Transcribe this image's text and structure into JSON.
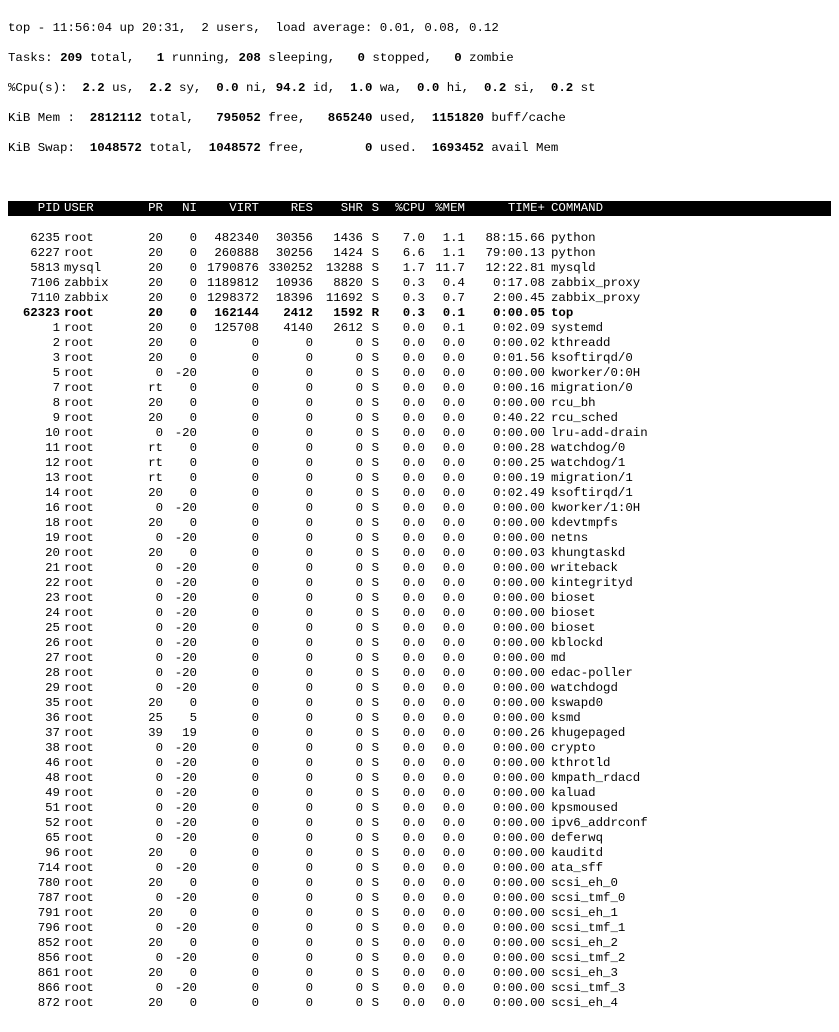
{
  "summary": {
    "l1": "top - 11:56:04 up 20:31,  2 users,  load average: 0.01, 0.08, 0.12",
    "l2a": "Tasks: ",
    "l2b": "209 ",
    "l2c": "total,   ",
    "l2d": "1 ",
    "l2e": "running, ",
    "l2f": "208 ",
    "l2g": "sleeping,   ",
    "l2h": "0 ",
    "l2i": "stopped,   ",
    "l2j": "0 ",
    "l2k": "zombie",
    "l3a": "%Cpu(s):  ",
    "l3b": "2.2 ",
    "l3c": "us,  ",
    "l3d": "2.2 ",
    "l3e": "sy,  ",
    "l3f": "0.0 ",
    "l3g": "ni, ",
    "l3h": "94.2 ",
    "l3i": "id,  ",
    "l3j": "1.0 ",
    "l3k": "wa,  ",
    "l3l": "0.0 ",
    "l3m": "hi,  ",
    "l3n": "0.2 ",
    "l3o": "si,  ",
    "l3p": "0.2 ",
    "l3q": "st",
    "l4a": "KiB Mem :  ",
    "l4b": "2812112 ",
    "l4c": "total,   ",
    "l4d": "795052 ",
    "l4e": "free,   ",
    "l4f": "865240 ",
    "l4g": "used,  ",
    "l4h": "1151820 ",
    "l4i": "buff/cache",
    "l5a": "KiB Swap:  ",
    "l5b": "1048572 ",
    "l5c": "total,  ",
    "l5d": "1048572 ",
    "l5e": "free,        ",
    "l5f": "0 ",
    "l5g": "used.  ",
    "l5h": "1693452 ",
    "l5i": "avail Mem"
  },
  "cols": {
    "pid": "PID",
    "user": "USER",
    "pr": "PR",
    "ni": "NI",
    "virt": "VIRT",
    "res": "RES",
    "shr": "SHR",
    "s": "S",
    "cpu": "%CPU",
    "mem": "%MEM",
    "time": "TIME+",
    "cmd": "COMMAND"
  },
  "rows": [
    {
      "pid": "6235",
      "user": "root",
      "pr": "20",
      "ni": "0",
      "virt": "482340",
      "res": "30356",
      "shr": "1436",
      "s": "S",
      "cpu": "7.0",
      "mem": "1.1",
      "time": "88:15.66",
      "cmd": "python"
    },
    {
      "pid": "6227",
      "user": "root",
      "pr": "20",
      "ni": "0",
      "virt": "260888",
      "res": "30256",
      "shr": "1424",
      "s": "S",
      "cpu": "6.6",
      "mem": "1.1",
      "time": "79:00.13",
      "cmd": "python"
    },
    {
      "pid": "5813",
      "user": "mysql",
      "pr": "20",
      "ni": "0",
      "virt": "1790876",
      "res": "330252",
      "shr": "13288",
      "s": "S",
      "cpu": "1.7",
      "mem": "11.7",
      "time": "12:22.81",
      "cmd": "mysqld"
    },
    {
      "pid": "7106",
      "user": "zabbix",
      "pr": "20",
      "ni": "0",
      "virt": "1189812",
      "res": "10936",
      "shr": "8820",
      "s": "S",
      "cpu": "0.3",
      "mem": "0.4",
      "time": "0:17.08",
      "cmd": "zabbix_proxy"
    },
    {
      "pid": "7110",
      "user": "zabbix",
      "pr": "20",
      "ni": "0",
      "virt": "1298372",
      "res": "18396",
      "shr": "11692",
      "s": "S",
      "cpu": "0.3",
      "mem": "0.7",
      "time": "2:00.45",
      "cmd": "zabbix_proxy"
    },
    {
      "pid": "62323",
      "user": "root",
      "pr": "20",
      "ni": "0",
      "virt": "162144",
      "res": "2412",
      "shr": "1592",
      "s": "R",
      "cpu": "0.3",
      "mem": "0.1",
      "time": "0:00.05",
      "cmd": "top",
      "bold": true
    },
    {
      "pid": "1",
      "user": "root",
      "pr": "20",
      "ni": "0",
      "virt": "125708",
      "res": "4140",
      "shr": "2612",
      "s": "S",
      "cpu": "0.0",
      "mem": "0.1",
      "time": "0:02.09",
      "cmd": "systemd"
    },
    {
      "pid": "2",
      "user": "root",
      "pr": "20",
      "ni": "0",
      "virt": "0",
      "res": "0",
      "shr": "0",
      "s": "S",
      "cpu": "0.0",
      "mem": "0.0",
      "time": "0:00.02",
      "cmd": "kthreadd"
    },
    {
      "pid": "3",
      "user": "root",
      "pr": "20",
      "ni": "0",
      "virt": "0",
      "res": "0",
      "shr": "0",
      "s": "S",
      "cpu": "0.0",
      "mem": "0.0",
      "time": "0:01.56",
      "cmd": "ksoftirqd/0"
    },
    {
      "pid": "5",
      "user": "root",
      "pr": "0",
      "ni": "-20",
      "virt": "0",
      "res": "0",
      "shr": "0",
      "s": "S",
      "cpu": "0.0",
      "mem": "0.0",
      "time": "0:00.00",
      "cmd": "kworker/0:0H"
    },
    {
      "pid": "7",
      "user": "root",
      "pr": "rt",
      "ni": "0",
      "virt": "0",
      "res": "0",
      "shr": "0",
      "s": "S",
      "cpu": "0.0",
      "mem": "0.0",
      "time": "0:00.16",
      "cmd": "migration/0"
    },
    {
      "pid": "8",
      "user": "root",
      "pr": "20",
      "ni": "0",
      "virt": "0",
      "res": "0",
      "shr": "0",
      "s": "S",
      "cpu": "0.0",
      "mem": "0.0",
      "time": "0:00.00",
      "cmd": "rcu_bh"
    },
    {
      "pid": "9",
      "user": "root",
      "pr": "20",
      "ni": "0",
      "virt": "0",
      "res": "0",
      "shr": "0",
      "s": "S",
      "cpu": "0.0",
      "mem": "0.0",
      "time": "0:40.22",
      "cmd": "rcu_sched"
    },
    {
      "pid": "10",
      "user": "root",
      "pr": "0",
      "ni": "-20",
      "virt": "0",
      "res": "0",
      "shr": "0",
      "s": "S",
      "cpu": "0.0",
      "mem": "0.0",
      "time": "0:00.00",
      "cmd": "lru-add-drain"
    },
    {
      "pid": "11",
      "user": "root",
      "pr": "rt",
      "ni": "0",
      "virt": "0",
      "res": "0",
      "shr": "0",
      "s": "S",
      "cpu": "0.0",
      "mem": "0.0",
      "time": "0:00.28",
      "cmd": "watchdog/0"
    },
    {
      "pid": "12",
      "user": "root",
      "pr": "rt",
      "ni": "0",
      "virt": "0",
      "res": "0",
      "shr": "0",
      "s": "S",
      "cpu": "0.0",
      "mem": "0.0",
      "time": "0:00.25",
      "cmd": "watchdog/1"
    },
    {
      "pid": "13",
      "user": "root",
      "pr": "rt",
      "ni": "0",
      "virt": "0",
      "res": "0",
      "shr": "0",
      "s": "S",
      "cpu": "0.0",
      "mem": "0.0",
      "time": "0:00.19",
      "cmd": "migration/1"
    },
    {
      "pid": "14",
      "user": "root",
      "pr": "20",
      "ni": "0",
      "virt": "0",
      "res": "0",
      "shr": "0",
      "s": "S",
      "cpu": "0.0",
      "mem": "0.0",
      "time": "0:02.49",
      "cmd": "ksoftirqd/1"
    },
    {
      "pid": "16",
      "user": "root",
      "pr": "0",
      "ni": "-20",
      "virt": "0",
      "res": "0",
      "shr": "0",
      "s": "S",
      "cpu": "0.0",
      "mem": "0.0",
      "time": "0:00.00",
      "cmd": "kworker/1:0H"
    },
    {
      "pid": "18",
      "user": "root",
      "pr": "20",
      "ni": "0",
      "virt": "0",
      "res": "0",
      "shr": "0",
      "s": "S",
      "cpu": "0.0",
      "mem": "0.0",
      "time": "0:00.00",
      "cmd": "kdevtmpfs"
    },
    {
      "pid": "19",
      "user": "root",
      "pr": "0",
      "ni": "-20",
      "virt": "0",
      "res": "0",
      "shr": "0",
      "s": "S",
      "cpu": "0.0",
      "mem": "0.0",
      "time": "0:00.00",
      "cmd": "netns"
    },
    {
      "pid": "20",
      "user": "root",
      "pr": "20",
      "ni": "0",
      "virt": "0",
      "res": "0",
      "shr": "0",
      "s": "S",
      "cpu": "0.0",
      "mem": "0.0",
      "time": "0:00.03",
      "cmd": "khungtaskd"
    },
    {
      "pid": "21",
      "user": "root",
      "pr": "0",
      "ni": "-20",
      "virt": "0",
      "res": "0",
      "shr": "0",
      "s": "S",
      "cpu": "0.0",
      "mem": "0.0",
      "time": "0:00.00",
      "cmd": "writeback"
    },
    {
      "pid": "22",
      "user": "root",
      "pr": "0",
      "ni": "-20",
      "virt": "0",
      "res": "0",
      "shr": "0",
      "s": "S",
      "cpu": "0.0",
      "mem": "0.0",
      "time": "0:00.00",
      "cmd": "kintegrityd"
    },
    {
      "pid": "23",
      "user": "root",
      "pr": "0",
      "ni": "-20",
      "virt": "0",
      "res": "0",
      "shr": "0",
      "s": "S",
      "cpu": "0.0",
      "mem": "0.0",
      "time": "0:00.00",
      "cmd": "bioset"
    },
    {
      "pid": "24",
      "user": "root",
      "pr": "0",
      "ni": "-20",
      "virt": "0",
      "res": "0",
      "shr": "0",
      "s": "S",
      "cpu": "0.0",
      "mem": "0.0",
      "time": "0:00.00",
      "cmd": "bioset"
    },
    {
      "pid": "25",
      "user": "root",
      "pr": "0",
      "ni": "-20",
      "virt": "0",
      "res": "0",
      "shr": "0",
      "s": "S",
      "cpu": "0.0",
      "mem": "0.0",
      "time": "0:00.00",
      "cmd": "bioset"
    },
    {
      "pid": "26",
      "user": "root",
      "pr": "0",
      "ni": "-20",
      "virt": "0",
      "res": "0",
      "shr": "0",
      "s": "S",
      "cpu": "0.0",
      "mem": "0.0",
      "time": "0:00.00",
      "cmd": "kblockd"
    },
    {
      "pid": "27",
      "user": "root",
      "pr": "0",
      "ni": "-20",
      "virt": "0",
      "res": "0",
      "shr": "0",
      "s": "S",
      "cpu": "0.0",
      "mem": "0.0",
      "time": "0:00.00",
      "cmd": "md"
    },
    {
      "pid": "28",
      "user": "root",
      "pr": "0",
      "ni": "-20",
      "virt": "0",
      "res": "0",
      "shr": "0",
      "s": "S",
      "cpu": "0.0",
      "mem": "0.0",
      "time": "0:00.00",
      "cmd": "edac-poller"
    },
    {
      "pid": "29",
      "user": "root",
      "pr": "0",
      "ni": "-20",
      "virt": "0",
      "res": "0",
      "shr": "0",
      "s": "S",
      "cpu": "0.0",
      "mem": "0.0",
      "time": "0:00.00",
      "cmd": "watchdogd"
    },
    {
      "pid": "35",
      "user": "root",
      "pr": "20",
      "ni": "0",
      "virt": "0",
      "res": "0",
      "shr": "0",
      "s": "S",
      "cpu": "0.0",
      "mem": "0.0",
      "time": "0:00.00",
      "cmd": "kswapd0"
    },
    {
      "pid": "36",
      "user": "root",
      "pr": "25",
      "ni": "5",
      "virt": "0",
      "res": "0",
      "shr": "0",
      "s": "S",
      "cpu": "0.0",
      "mem": "0.0",
      "time": "0:00.00",
      "cmd": "ksmd"
    },
    {
      "pid": "37",
      "user": "root",
      "pr": "39",
      "ni": "19",
      "virt": "0",
      "res": "0",
      "shr": "0",
      "s": "S",
      "cpu": "0.0",
      "mem": "0.0",
      "time": "0:00.26",
      "cmd": "khugepaged"
    },
    {
      "pid": "38",
      "user": "root",
      "pr": "0",
      "ni": "-20",
      "virt": "0",
      "res": "0",
      "shr": "0",
      "s": "S",
      "cpu": "0.0",
      "mem": "0.0",
      "time": "0:00.00",
      "cmd": "crypto"
    },
    {
      "pid": "46",
      "user": "root",
      "pr": "0",
      "ni": "-20",
      "virt": "0",
      "res": "0",
      "shr": "0",
      "s": "S",
      "cpu": "0.0",
      "mem": "0.0",
      "time": "0:00.00",
      "cmd": "kthrotld"
    },
    {
      "pid": "48",
      "user": "root",
      "pr": "0",
      "ni": "-20",
      "virt": "0",
      "res": "0",
      "shr": "0",
      "s": "S",
      "cpu": "0.0",
      "mem": "0.0",
      "time": "0:00.00",
      "cmd": "kmpath_rdacd"
    },
    {
      "pid": "49",
      "user": "root",
      "pr": "0",
      "ni": "-20",
      "virt": "0",
      "res": "0",
      "shr": "0",
      "s": "S",
      "cpu": "0.0",
      "mem": "0.0",
      "time": "0:00.00",
      "cmd": "kaluad"
    },
    {
      "pid": "51",
      "user": "root",
      "pr": "0",
      "ni": "-20",
      "virt": "0",
      "res": "0",
      "shr": "0",
      "s": "S",
      "cpu": "0.0",
      "mem": "0.0",
      "time": "0:00.00",
      "cmd": "kpsmoused"
    },
    {
      "pid": "52",
      "user": "root",
      "pr": "0",
      "ni": "-20",
      "virt": "0",
      "res": "0",
      "shr": "0",
      "s": "S",
      "cpu": "0.0",
      "mem": "0.0",
      "time": "0:00.00",
      "cmd": "ipv6_addrconf"
    },
    {
      "pid": "65",
      "user": "root",
      "pr": "0",
      "ni": "-20",
      "virt": "0",
      "res": "0",
      "shr": "0",
      "s": "S",
      "cpu": "0.0",
      "mem": "0.0",
      "time": "0:00.00",
      "cmd": "deferwq"
    },
    {
      "pid": "96",
      "user": "root",
      "pr": "20",
      "ni": "0",
      "virt": "0",
      "res": "0",
      "shr": "0",
      "s": "S",
      "cpu": "0.0",
      "mem": "0.0",
      "time": "0:00.00",
      "cmd": "kauditd"
    },
    {
      "pid": "714",
      "user": "root",
      "pr": "0",
      "ni": "-20",
      "virt": "0",
      "res": "0",
      "shr": "0",
      "s": "S",
      "cpu": "0.0",
      "mem": "0.0",
      "time": "0:00.00",
      "cmd": "ata_sff"
    },
    {
      "pid": "780",
      "user": "root",
      "pr": "20",
      "ni": "0",
      "virt": "0",
      "res": "0",
      "shr": "0",
      "s": "S",
      "cpu": "0.0",
      "mem": "0.0",
      "time": "0:00.00",
      "cmd": "scsi_eh_0"
    },
    {
      "pid": "787",
      "user": "root",
      "pr": "0",
      "ni": "-20",
      "virt": "0",
      "res": "0",
      "shr": "0",
      "s": "S",
      "cpu": "0.0",
      "mem": "0.0",
      "time": "0:00.00",
      "cmd": "scsi_tmf_0"
    },
    {
      "pid": "791",
      "user": "root",
      "pr": "20",
      "ni": "0",
      "virt": "0",
      "res": "0",
      "shr": "0",
      "s": "S",
      "cpu": "0.0",
      "mem": "0.0",
      "time": "0:00.00",
      "cmd": "scsi_eh_1"
    },
    {
      "pid": "796",
      "user": "root",
      "pr": "0",
      "ni": "-20",
      "virt": "0",
      "res": "0",
      "shr": "0",
      "s": "S",
      "cpu": "0.0",
      "mem": "0.0",
      "time": "0:00.00",
      "cmd": "scsi_tmf_1"
    },
    {
      "pid": "852",
      "user": "root",
      "pr": "20",
      "ni": "0",
      "virt": "0",
      "res": "0",
      "shr": "0",
      "s": "S",
      "cpu": "0.0",
      "mem": "0.0",
      "time": "0:00.00",
      "cmd": "scsi_eh_2"
    },
    {
      "pid": "856",
      "user": "root",
      "pr": "0",
      "ni": "-20",
      "virt": "0",
      "res": "0",
      "shr": "0",
      "s": "S",
      "cpu": "0.0",
      "mem": "0.0",
      "time": "0:00.00",
      "cmd": "scsi_tmf_2"
    },
    {
      "pid": "861",
      "user": "root",
      "pr": "20",
      "ni": "0",
      "virt": "0",
      "res": "0",
      "shr": "0",
      "s": "S",
      "cpu": "0.0",
      "mem": "0.0",
      "time": "0:00.00",
      "cmd": "scsi_eh_3"
    },
    {
      "pid": "866",
      "user": "root",
      "pr": "0",
      "ni": "-20",
      "virt": "0",
      "res": "0",
      "shr": "0",
      "s": "S",
      "cpu": "0.0",
      "mem": "0.0",
      "time": "0:00.00",
      "cmd": "scsi_tmf_3"
    },
    {
      "pid": "872",
      "user": "root",
      "pr": "20",
      "ni": "0",
      "virt": "0",
      "res": "0",
      "shr": "0",
      "s": "S",
      "cpu": "0.0",
      "mem": "0.0",
      "time": "0:00.00",
      "cmd": "scsi_eh_4"
    }
  ]
}
